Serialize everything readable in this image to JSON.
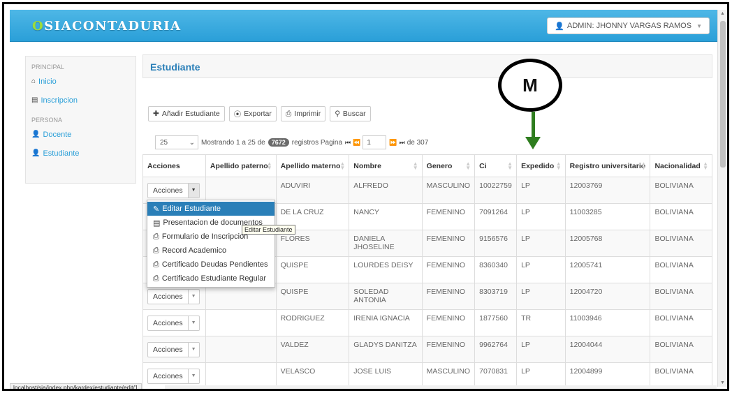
{
  "app": {
    "brand_prefix": "O",
    "brand_name": "SIACONTADURIA"
  },
  "user": {
    "label": "ADMIN: JHONNY VARGAS RAMOS"
  },
  "sidebar": {
    "sections": [
      {
        "heading": "PRINCIPAL",
        "items": [
          {
            "label": "Inicio",
            "icon": "home-icon"
          },
          {
            "label": "Inscripcion",
            "icon": "folder-icon"
          }
        ]
      },
      {
        "heading": "PERSONA",
        "items": [
          {
            "label": "Docente",
            "icon": "user-icon"
          },
          {
            "label": "Estudiante",
            "icon": "user-icon"
          }
        ]
      }
    ]
  },
  "panel": {
    "title": "Estudiante"
  },
  "toolbar": {
    "add": "Añadir Estudiante",
    "export": "Exportar",
    "print": "Imprimir",
    "search": "Buscar"
  },
  "pager": {
    "page_size": "25",
    "showing": "Mostrando 1 a 25 de",
    "total": "7672",
    "records_page": "registros Pagina",
    "current_page": "1",
    "of_pages": "de 307"
  },
  "table": {
    "headers": [
      "Acciones",
      "Apellido paterno",
      "Apellido materno",
      "Nombre",
      "Genero",
      "Ci",
      "Expedido",
      "Registro universitario",
      "Nacionalidad"
    ],
    "action_label": "Acciones",
    "rows": [
      [
        "",
        "ADUVIRI",
        "ALFREDO",
        "MASCULINO",
        "10022759",
        "LP",
        "12003769",
        "BOLIVIANA"
      ],
      [
        "",
        "DE LA CRUZ",
        "NANCY",
        "FEMENINO",
        "7091264",
        "LP",
        "11003285",
        "BOLIVIANA"
      ],
      [
        "",
        "FLORES",
        "DANIELA JHOSELINE",
        "FEMENINO",
        "9156576",
        "LP",
        "12005768",
        "BOLIVIANA"
      ],
      [
        "",
        "QUISPE",
        "LOURDES DEISY",
        "FEMENINO",
        "8360340",
        "LP",
        "12005741",
        "BOLIVIANA"
      ],
      [
        "",
        "QUISPE",
        "SOLEDAD ANTONIA",
        "FEMENINO",
        "8303719",
        "LP",
        "12004720",
        "BOLIVIANA"
      ],
      [
        "",
        "RODRIGUEZ",
        "IRENIA IGNACIA",
        "FEMENINO",
        "1877560",
        "TR",
        "11003946",
        "BOLIVIANA"
      ],
      [
        "",
        "VALDEZ",
        "GLADYS DANITZA",
        "FEMENINO",
        "9962764",
        "LP",
        "12004044",
        "BOLIVIANA"
      ],
      [
        "",
        "VELASCO",
        "JOSE LUIS",
        "MASCULINO",
        "7070831",
        "LP",
        "12004899",
        "BOLIVIANA"
      ]
    ]
  },
  "menu": {
    "items": [
      {
        "label": "Editar Estudiante",
        "icon": "pencil-icon"
      },
      {
        "label": "Presentacion de documentos",
        "icon": "document-icon"
      },
      {
        "label": "Formulario de Inscripcion",
        "icon": "print-icon"
      },
      {
        "label": "Record Academico",
        "icon": "print-icon"
      },
      {
        "label": "Certificado Deudas Pendientes",
        "icon": "print-icon"
      },
      {
        "label": "Certificado Estudiante Regular",
        "icon": "print-icon"
      }
    ],
    "tooltip": "Editar Estudiante"
  },
  "annotation": {
    "label": "M"
  },
  "status_url": "localhost/sia/index.php/kardex/estudiante/edit/1"
}
